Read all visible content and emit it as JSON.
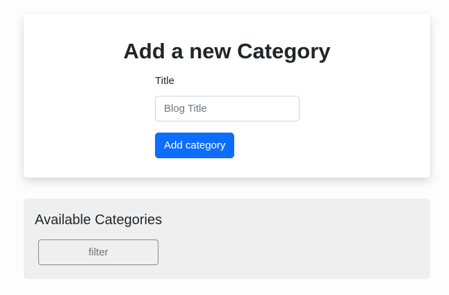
{
  "add_category_card": {
    "title": "Add a new Category",
    "form": {
      "title_label": "Title",
      "title_placeholder": "Blog Title",
      "title_value": "",
      "submit_label": "Add category"
    }
  },
  "categories_panel": {
    "heading": "Available Categories",
    "filter_placeholder": "filter",
    "filter_value": ""
  },
  "colors": {
    "primary_button": "#0d6efd",
    "panel_background": "#efefef",
    "card_background": "#ffffff"
  }
}
